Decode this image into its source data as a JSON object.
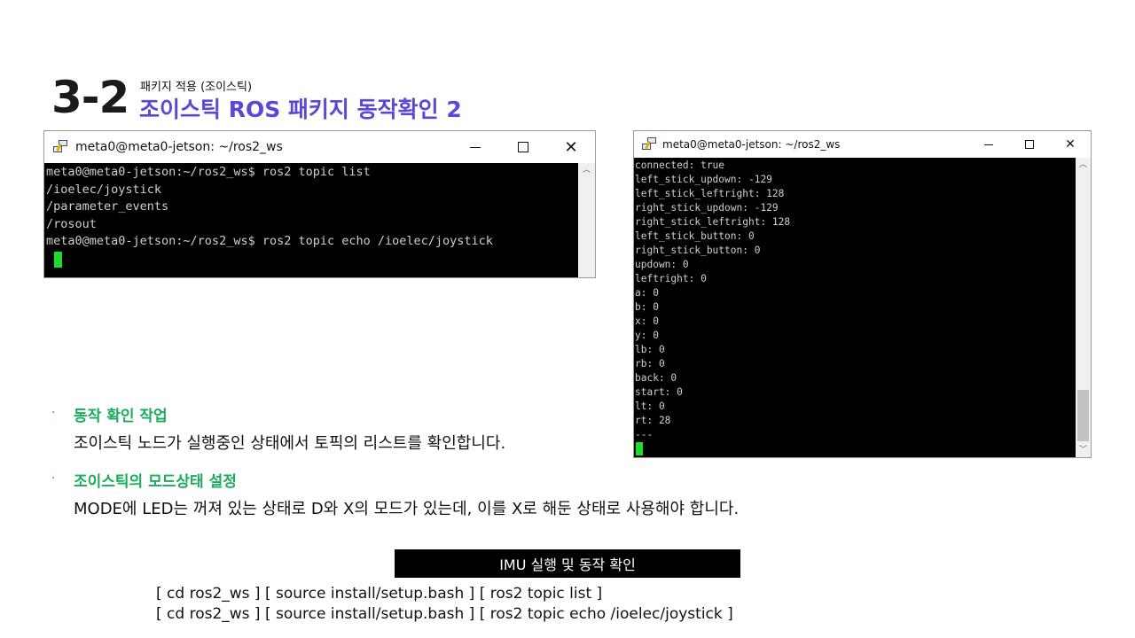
{
  "header": {
    "section_number": "3-2",
    "subtitle_small": "패키지 적용 (조이스틱)",
    "subtitle_main": "조이스틱 ROS 패키지 동작확인 2"
  },
  "colors": {
    "accent_purple": "#5b48d6",
    "accent_green": "#1aab5d",
    "cursor_green": "#1cdc2c"
  },
  "window_left": {
    "title": "meta0@meta0-jetson: ~/ros2_ws",
    "icon": "putty-icon",
    "lines": [
      "meta0@meta0-jetson:~/ros2_ws$ ros2 topic list",
      "/ioelec/joystick",
      "/parameter_events",
      "/rosout",
      "meta0@meta0-jetson:~/ros2_ws$ ros2 topic echo /ioelec/joystick"
    ]
  },
  "window_right": {
    "title": "meta0@meta0-jetson: ~/ros2_ws",
    "icon": "putty-icon",
    "lines": [
      "connected: true",
      "left_stick_updown: -129",
      "left_stick_leftright: 128",
      "right_stick_updown: -129",
      "right_stick_leftright: 128",
      "left_stick_button: 0",
      "right_stick_button: 0",
      "updown: 0",
      "leftright: 0",
      "a: 0",
      "b: 0",
      "x: 0",
      "y: 0",
      "lb: 0",
      "rb: 0",
      "back: 0",
      "start: 0",
      "lt: 0",
      "rt: 28",
      "---"
    ]
  },
  "window_controls": {
    "minimize": "–",
    "maximize": "□",
    "close": "✕"
  },
  "bullets": [
    {
      "heading": "동작 확인 작업",
      "text": "조이스틱 노드가 실행중인 상태에서 토픽의 리스트를 확인합니다."
    },
    {
      "heading": "조이스틱의 모드상태 설정",
      "text": "MODE에 LED는 꺼져 있는 상태로 D와 X의 모드가 있는데, 이를 X로 해둔 상태로 사용해야 합니다."
    }
  ],
  "bullet_marker": "·",
  "imu_label": "IMU 실행 및 동작 확인",
  "commands": [
    "[ cd ros2_ws ] [ source install/setup.bash ] [ ros2 topic list ]",
    "[ cd ros2_ws ] [ source install/setup.bash ] [ ros2 topic echo /ioelec/joystick ]"
  ]
}
